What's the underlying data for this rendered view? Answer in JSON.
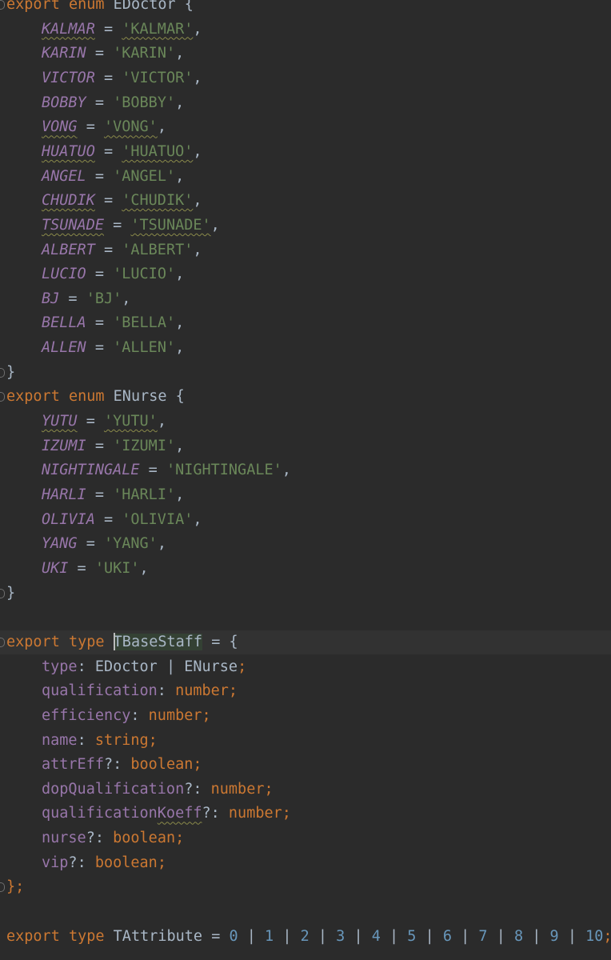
{
  "doctor_enum": {
    "keyword_export": "export",
    "keyword_enum": "enum",
    "name": "EDoctor",
    "open": " {",
    "members": [
      {
        "key": "KALMAR",
        "value": "'KALMAR'",
        "squiggle": true
      },
      {
        "key": "KARIN",
        "value": "'KARIN'",
        "squiggle": false
      },
      {
        "key": "VICTOR",
        "value": "'VICTOR'",
        "squiggle": false
      },
      {
        "key": "BOBBY",
        "value": "'BOBBY'",
        "squiggle": false
      },
      {
        "key": "VONG",
        "value": "'VONG'",
        "squiggle": true
      },
      {
        "key": "HUATUO",
        "value": "'HUATUO'",
        "squiggle": true
      },
      {
        "key": "ANGEL",
        "value": "'ANGEL'",
        "squiggle": false
      },
      {
        "key": "CHUDIK",
        "value": "'CHUDIK'",
        "squiggle": true
      },
      {
        "key": "TSUNADE",
        "value": "'TSUNADE'",
        "squiggle": true
      },
      {
        "key": "ALBERT",
        "value": "'ALBERT'",
        "squiggle": false
      },
      {
        "key": "LUCIO",
        "value": "'LUCIO'",
        "squiggle": false
      },
      {
        "key": "BJ",
        "value": "'BJ'",
        "squiggle": false
      },
      {
        "key": "BELLA",
        "value": "'BELLA'",
        "squiggle": false
      },
      {
        "key": "ALLEN",
        "value": "'ALLEN'",
        "squiggle": false
      }
    ],
    "close": "}"
  },
  "nurse_enum": {
    "keyword_export": "export",
    "keyword_enum": "enum",
    "name": "ENurse",
    "open": " {",
    "members": [
      {
        "key": "YUTU",
        "value": "'YUTU'",
        "squiggle": true
      },
      {
        "key": "IZUMI",
        "value": "'IZUMI'",
        "squiggle": false
      },
      {
        "key": "NIGHTINGALE",
        "value": "'NIGHTINGALE'",
        "squiggle": false
      },
      {
        "key": "HARLI",
        "value": "'HARLI'",
        "squiggle": false
      },
      {
        "key": "OLIVIA",
        "value": "'OLIVIA'",
        "squiggle": false
      },
      {
        "key": "YANG",
        "value": "'YANG'",
        "squiggle": false
      },
      {
        "key": "UKI",
        "value": "'UKI'",
        "squiggle": false
      }
    ],
    "close": "}"
  },
  "base_staff_type": {
    "keyword_export": "export",
    "keyword_type": "type",
    "name": "TBaseStaff",
    "open": " = {",
    "fields": [
      {
        "name": "type",
        "optional": "",
        "colon": ": ",
        "type": "EDoctor | ENurse",
        "type_kind": "cls",
        "squiggle_from": null
      },
      {
        "name": "qualification",
        "optional": "",
        "colon": ": ",
        "type": "number",
        "type_kind": "typ",
        "squiggle_from": null
      },
      {
        "name": "efficiency",
        "optional": "",
        "colon": ": ",
        "type": "number",
        "type_kind": "typ",
        "squiggle_from": null
      },
      {
        "name": "name",
        "optional": "",
        "colon": ": ",
        "type": "string",
        "type_kind": "typ",
        "squiggle_from": null
      },
      {
        "name": "attrEff",
        "optional": "?",
        "colon": ": ",
        "type": "boolean",
        "type_kind": "typ",
        "squiggle_from": null
      },
      {
        "name": "dopQualification",
        "optional": "?",
        "colon": ": ",
        "type": "number",
        "type_kind": "typ",
        "squiggle_from": null
      },
      {
        "name": "qualificationKoeff",
        "optional": "?",
        "colon": ": ",
        "type": "number",
        "type_kind": "typ",
        "squiggle_from": "Koeff"
      },
      {
        "name": "nurse",
        "optional": "?",
        "colon": ": ",
        "type": "boolean",
        "type_kind": "typ",
        "squiggle_from": null
      },
      {
        "name": "vip",
        "optional": "?",
        "colon": ": ",
        "type": "boolean",
        "type_kind": "typ",
        "squiggle_from": null
      }
    ],
    "close": "};"
  },
  "attribute_type": {
    "keyword_export": "export",
    "keyword_type": "type",
    "name": "TAttribute",
    "eq": " = ",
    "values": [
      "0",
      "1",
      "2",
      "3",
      "4",
      "5",
      "6",
      "7",
      "8",
      "9",
      "10"
    ],
    "separator": " | ",
    "end": ";"
  },
  "colors": {
    "background": "#2b2b2b",
    "keyword": "#cc7832",
    "enum_member": "#9876aa",
    "string": "#6a8759",
    "number": "#6897bb",
    "default_text": "#a9b7c6"
  }
}
